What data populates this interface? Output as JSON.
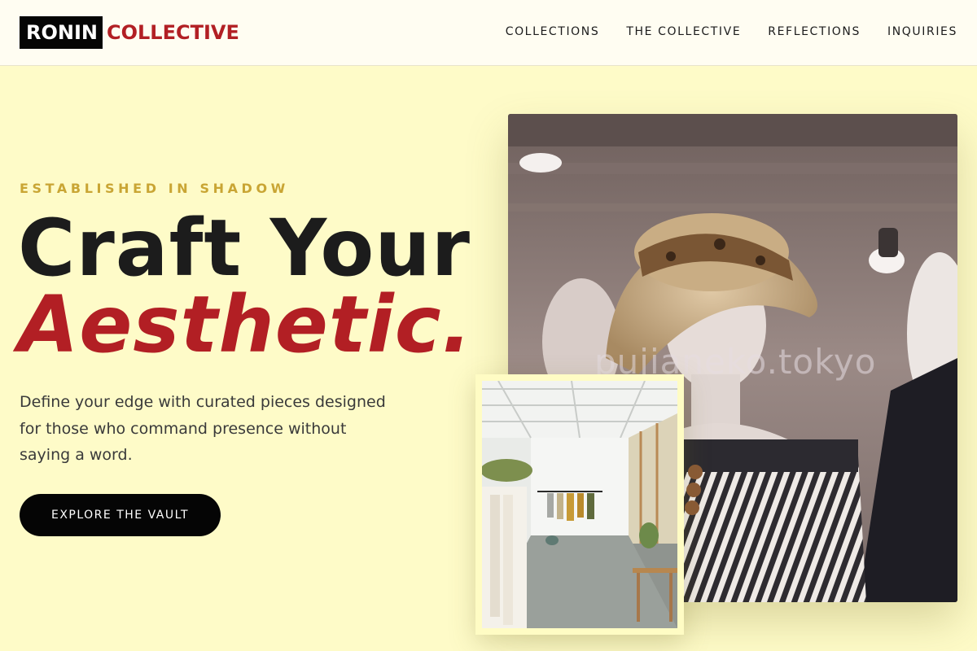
{
  "header": {
    "logo_box": "RONIN",
    "logo_rest": "COLLECTIVE",
    "nav": [
      "COLLECTIONS",
      "THE COLLECTIVE",
      "REFLECTIONS",
      "INQUIRIES"
    ]
  },
  "hero": {
    "eyebrow": "ESTABLISHED IN SHADOW",
    "headline_line1": "Craft Your",
    "headline_line2": "Aesthetic.",
    "lede": "Define your edge with curated pieces designed for those who command presence without saying a word.",
    "cta": "EXPLORE THE VAULT",
    "photo_watermark": "pujianeko.tokyo"
  },
  "colors": {
    "page_bg": "#fefbc8",
    "accent_red": "#b21f24",
    "accent_gold": "#c9a534",
    "ink": "#1c1c1c"
  }
}
